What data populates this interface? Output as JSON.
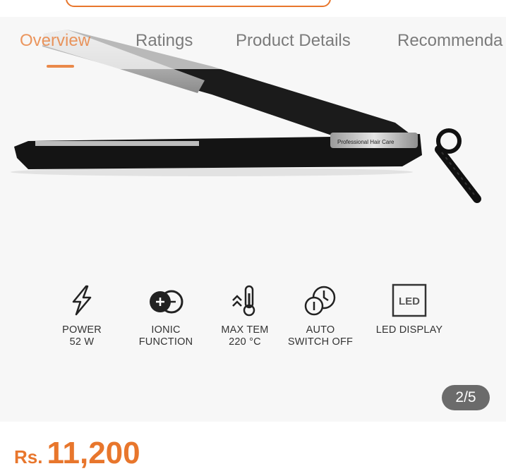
{
  "tabs": [
    {
      "label": "Overview",
      "active": true
    },
    {
      "label": "Ratings",
      "active": false
    },
    {
      "label": "Product Details",
      "active": false
    },
    {
      "label": "Recommenda",
      "active": false
    }
  ],
  "product": {
    "brand_label": "Professional Hair Care",
    "features": [
      {
        "icon": "lightning-bolt-icon",
        "label": "POWER\n52 W"
      },
      {
        "icon": "ionic-plus-minus-icon",
        "label": "IONIC\nFUNCTION"
      },
      {
        "icon": "thermometer-icon",
        "label": "MAX TEM\n220 °C"
      },
      {
        "icon": "timer-clock-icon",
        "label": "AUTO\nSWITCH OFF"
      },
      {
        "icon": "led-box-icon",
        "label": "LED DISPLAY",
        "icon_text": "LED"
      }
    ]
  },
  "gallery": {
    "counter": "2/5"
  },
  "price": {
    "currency": "Rs.",
    "amount": "11,200"
  },
  "colors": {
    "accent": "#e8762c",
    "counter_bg": "#6b6b6b"
  }
}
